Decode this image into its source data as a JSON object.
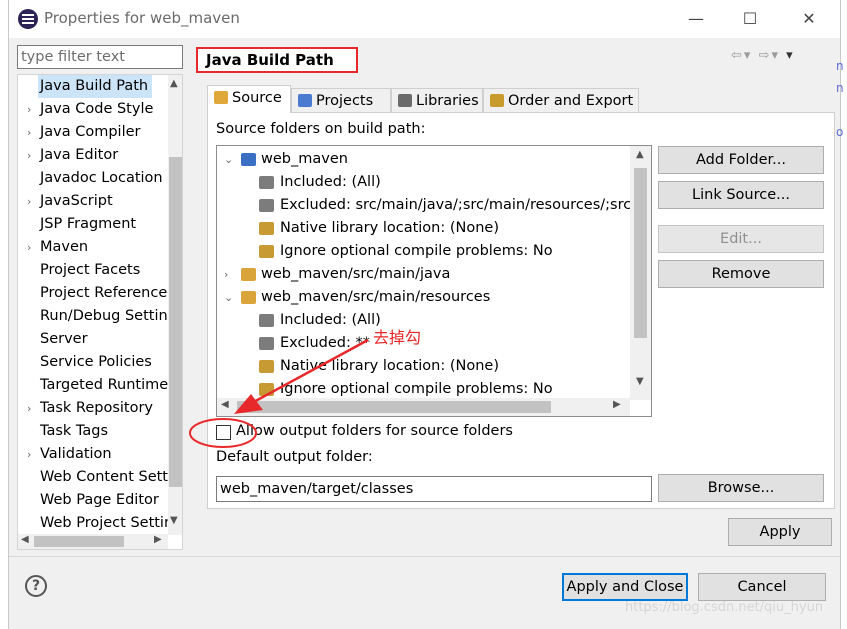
{
  "window": {
    "title": "Properties for web_maven",
    "minimize_label": "—",
    "maximize_label": "☐",
    "close_label": "✕"
  },
  "filter": {
    "placeholder": "type filter text"
  },
  "nav_tree": {
    "items": [
      {
        "label": "Java Build Path",
        "selected": true,
        "expandable": false
      },
      {
        "label": "Java Code Style",
        "expandable": true
      },
      {
        "label": "Java Compiler",
        "expandable": true
      },
      {
        "label": "Java Editor",
        "expandable": true
      },
      {
        "label": "Javadoc Location",
        "expandable": false
      },
      {
        "label": "JavaScript",
        "expandable": true
      },
      {
        "label": "JSP Fragment",
        "expandable": false
      },
      {
        "label": "Maven",
        "expandable": true
      },
      {
        "label": "Project Facets",
        "expandable": false
      },
      {
        "label": "Project References",
        "expandable": false
      },
      {
        "label": "Run/Debug Settings",
        "expandable": false
      },
      {
        "label": "Server",
        "expandable": false
      },
      {
        "label": "Service Policies",
        "expandable": false
      },
      {
        "label": "Targeted Runtimes",
        "expandable": false
      },
      {
        "label": "Task Repository",
        "expandable": true
      },
      {
        "label": "Task Tags",
        "expandable": false
      },
      {
        "label": "Validation",
        "expandable": true
      },
      {
        "label": "Web Content Settings",
        "expandable": false
      },
      {
        "label": "Web Page Editor",
        "expandable": false
      },
      {
        "label": "Web Project Settings",
        "expandable": false
      }
    ]
  },
  "page": {
    "title": "Java Build Path"
  },
  "tabs": [
    {
      "label": "Source",
      "active": true,
      "icon": "source-folder-icon",
      "color": "#e0a73a"
    },
    {
      "label": "Projects",
      "active": false,
      "icon": "projects-icon",
      "color": "#4a7bd1"
    },
    {
      "label": "Libraries",
      "active": false,
      "icon": "libraries-icon",
      "color": "#6b6b6b"
    },
    {
      "label": "Order and Export",
      "active": false,
      "icon": "order-export-icon",
      "color": "#c89b2c"
    }
  ],
  "source_panel": {
    "label": "Source folders on build path:",
    "rows": [
      {
        "text": "web_maven",
        "level": 0,
        "chevron": "down",
        "icon": "project-folder-icon",
        "color": "#3b6fc4"
      },
      {
        "text": "Included: (All)",
        "level": 1,
        "icon": "filter-include-icon",
        "color": "#7c7c7c"
      },
      {
        "text": "Excluded: src/main/java/;src/main/resources/;src/test/java/",
        "level": 1,
        "icon": "filter-exclude-icon",
        "color": "#7c7c7c"
      },
      {
        "text": "Native library location: (None)",
        "level": 1,
        "icon": "native-library-icon",
        "color": "#c79a34"
      },
      {
        "text": "Ignore optional compile problems: No",
        "level": 1,
        "icon": "ignore-problems-icon",
        "color": "#c79a34"
      },
      {
        "text": "web_maven/src/main/java",
        "level": 0,
        "chevron": "right",
        "icon": "package-folder-icon",
        "color": "#d9a43a"
      },
      {
        "text": "web_maven/src/main/resources",
        "level": 0,
        "chevron": "down",
        "icon": "package-folder-icon",
        "color": "#d9a43a"
      },
      {
        "text": "Included: (All)",
        "level": 1,
        "icon": "filter-include-icon",
        "color": "#7c7c7c"
      },
      {
        "text": "Excluded: **",
        "level": 1,
        "icon": "filter-exclude-icon",
        "color": "#7c7c7c"
      },
      {
        "text": "Native library location: (None)",
        "level": 1,
        "icon": "native-library-icon",
        "color": "#c79a34"
      },
      {
        "text": "Ignore optional compile problems: No",
        "level": 1,
        "icon": "ignore-problems-icon",
        "color": "#c79a34"
      }
    ],
    "buttons": {
      "add_folder": "Add Folder...",
      "link_source": "Link Source...",
      "edit": "Edit...",
      "remove": "Remove"
    }
  },
  "options": {
    "allow_output_label": "Allow output folders for source folders",
    "allow_output_checked": false,
    "default_output_label": "Default output folder:",
    "default_output_value": "web_maven/target/classes",
    "browse_label": "Browse..."
  },
  "actions": {
    "apply": "Apply",
    "apply_and_close": "Apply and Close",
    "cancel": "Cancel"
  },
  "annotation": {
    "text": "去掉勾",
    "color": "#e8292b"
  },
  "watermark": "https://blog.csdn.net/qiu_hyun",
  "colors": {
    "highlight": "#e8292b",
    "selection": "#cce4f7",
    "focus": "#0078d7"
  }
}
